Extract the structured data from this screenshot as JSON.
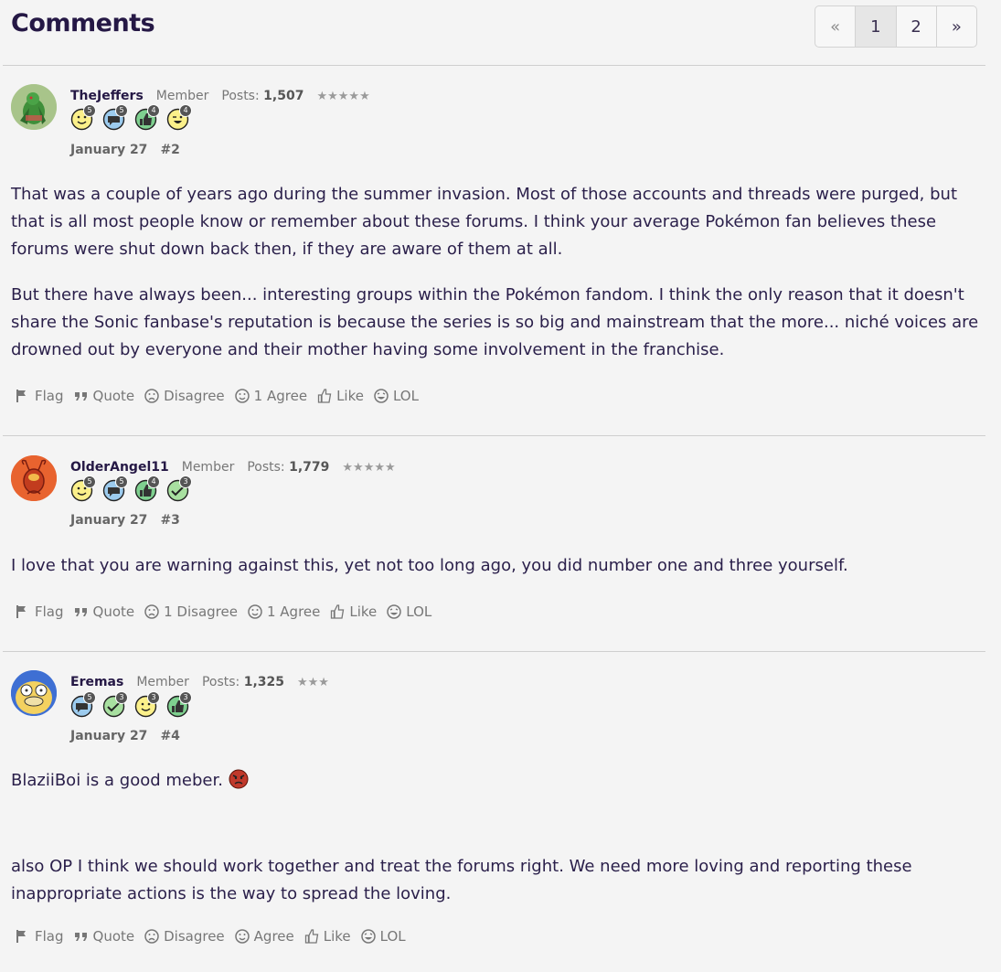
{
  "header": {
    "title": "Comments",
    "pagination": {
      "prev": "«",
      "pages": [
        "1",
        "2"
      ],
      "current": "1",
      "next": "»"
    }
  },
  "comments": [
    {
      "username": "TheJeffers",
      "role": "Member",
      "posts_label": "Posts:",
      "posts": "1,507",
      "stars": "★★★★★",
      "badges": [
        {
          "icon": "smiley-badge-icon",
          "count": "5"
        },
        {
          "icon": "speech-badge-icon",
          "count": "5"
        },
        {
          "icon": "thumbsup-badge-icon",
          "count": "4"
        },
        {
          "icon": "wink-badge-icon",
          "count": "4"
        }
      ],
      "date": "January 27",
      "post_id": "#2",
      "paragraphs": [
        "That was a couple of years ago during the summer invasion. Most of those accounts and threads were purged, but that is all most people know or remember about these forums. I think your average Pokémon fan believes these forums were shut down back then, if they are aware of them at all.",
        "But there have always been... interesting groups within the Pokémon fandom. I think the only reason that it doesn't share the Sonic fanbase's reputation is because the series is so big and mainstream that the more... niché voices are drowned out by everyone and their mother having some involvement in the franchise."
      ],
      "actions": {
        "flag": "Flag",
        "quote": "Quote",
        "disagree": "Disagree",
        "agree": "1 Agree",
        "like": "Like",
        "lol": "LOL"
      }
    },
    {
      "username": "OlderAngel11",
      "role": "Member",
      "posts_label": "Posts:",
      "posts": "1,779",
      "stars": "★★★★★",
      "badges": [
        {
          "icon": "smiley-badge-icon",
          "count": "5"
        },
        {
          "icon": "speech-badge-icon",
          "count": "5"
        },
        {
          "icon": "thumbsup-badge-icon",
          "count": "4"
        },
        {
          "icon": "check-badge-icon",
          "count": "3"
        }
      ],
      "date": "January 27",
      "post_id": "#3",
      "paragraphs": [
        "I love that you are warning against this, yet not too long ago, you did number one and three yourself."
      ],
      "actions": {
        "flag": "Flag",
        "quote": "Quote",
        "disagree": "1 Disagree",
        "agree": "1 Agree",
        "like": "Like",
        "lol": "LOL"
      }
    },
    {
      "username": "Eremas",
      "role": "Member",
      "posts_label": "Posts:",
      "posts": "1,325",
      "stars": "★★★",
      "badges": [
        {
          "icon": "speech-badge-icon",
          "count": "5"
        },
        {
          "icon": "check-badge-icon",
          "count": "3"
        },
        {
          "icon": "smiley-badge-icon",
          "count": "3"
        },
        {
          "icon": "thumbsup-badge-icon",
          "count": "3"
        }
      ],
      "date": "January 27",
      "post_id": "#4",
      "paragraphs": [
        "BlaziiBoi is a good meber.",
        "also OP I think we should work together and treat the forums right. We need more loving and reporting these inappropriate actions is the way to spread the loving."
      ],
      "actions": {
        "flag": "Flag",
        "quote": "Quote",
        "disagree": "Disagree",
        "agree": "Agree",
        "like": "Like",
        "lol": "LOL"
      }
    }
  ],
  "colors": {
    "background": "#f4f4f4",
    "text": "#2a1f4a",
    "muted": "#777777"
  }
}
